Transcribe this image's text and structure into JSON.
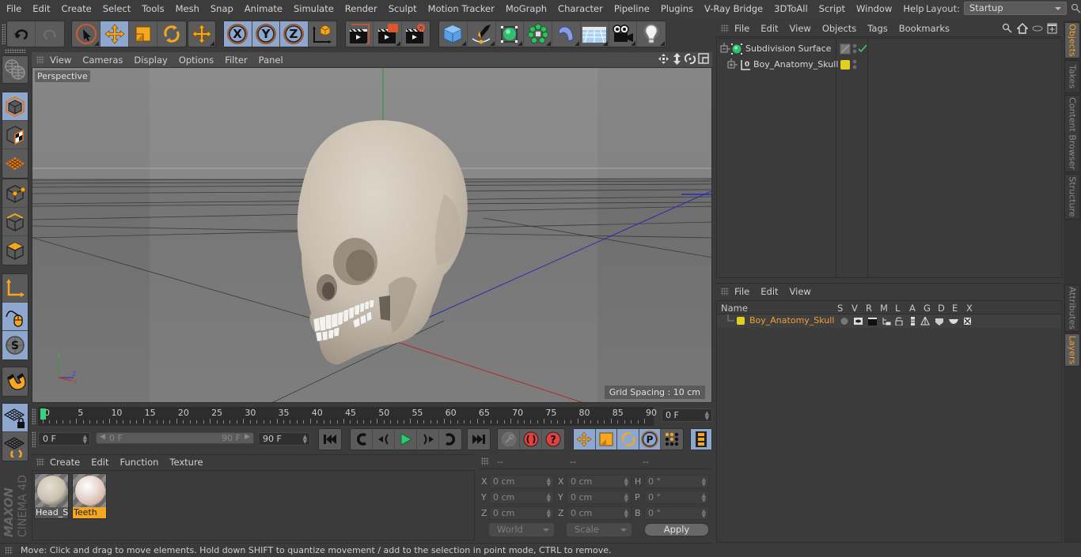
{
  "app": "Cinema 4D",
  "menubar": {
    "items": [
      "File",
      "Edit",
      "Create",
      "Select",
      "Tools",
      "Mesh",
      "Snap",
      "Animate",
      "Simulate",
      "Render",
      "Sculpt",
      "Motion Tracker",
      "MoGraph",
      "Character",
      "Pipeline",
      "Plugins",
      "V-Ray Bridge",
      "3DToAll",
      "Script",
      "Window",
      "Help"
    ],
    "layout_label": "Layout:",
    "layout_value": "Startup"
  },
  "toolbar": {
    "icons": [
      "undo-icon",
      "redo-icon",
      "select-live-icon",
      "move-icon",
      "scale-icon",
      "rotate-icon",
      "move-recent-icon",
      "x-axis-icon",
      "y-axis-icon",
      "z-axis-icon",
      "world-coords-icon",
      "render-view-icon",
      "render-picture-viewer-icon",
      "render-settings-icon",
      "cube-primitive-icon",
      "pen-spline-icon",
      "subdivision-surface-icon",
      "mograph-cloner-icon",
      "deformer-bend-icon",
      "floor-environment-icon",
      "camera-icon",
      "light-icon"
    ]
  },
  "leftbar": {
    "icons": [
      "make-editable-icon",
      "model-mode-icon",
      "texture-mode-icon",
      "workplane-mode-icon",
      "points-mode-icon",
      "edges-mode-icon",
      "polygons-mode-icon",
      "axis-mode-icon",
      "tweak-mode-icon",
      "solo-mode-icon",
      "snapping-icon",
      "locked-workplane-icon",
      "planar-workplane-icon"
    ]
  },
  "viewport": {
    "menu": [
      "View",
      "Cameras",
      "Display",
      "Options",
      "Filter",
      "Panel"
    ],
    "camera_label": "Perspective",
    "grid_spacing": "Grid Spacing : 10 cm",
    "axis_labels": {
      "y": "Y",
      "z": "Z",
      "x": "X"
    },
    "object": "Boy_Anatomy_Skull"
  },
  "timeline": {
    "ticks": [
      "0",
      "5",
      "10",
      "15",
      "20",
      "25",
      "30",
      "35",
      "40",
      "45",
      "50",
      "55",
      "60",
      "65",
      "70",
      "75",
      "80",
      "85",
      "90"
    ],
    "current_frame": "0 F",
    "start_field": "0 F",
    "range_start": "0 F",
    "range_end": "90 F",
    "end_field": "90 F",
    "max_frame": 90,
    "current_value": 0
  },
  "transport": {
    "buttons": [
      "go-to-start",
      "go-to-previous-keyframe",
      "play-backwards",
      "play-forwards",
      "go-to-next-keyframe",
      "go-to-end"
    ],
    "record_buttons": [
      "motion-record",
      "record-active-objects",
      "autokeying"
    ],
    "key_buttons": [
      "key-position",
      "key-scale",
      "key-rotation",
      "key-parameter",
      "key-point-level-animation",
      "timeline-window"
    ]
  },
  "materials": {
    "menu": [
      "Create",
      "Edit",
      "Function",
      "Texture"
    ],
    "items": [
      {
        "name": "Head_Sk",
        "selected": false,
        "color": "#d8d0c0"
      },
      {
        "name": "Teeth",
        "selected": true,
        "color": "#f0e2dc"
      }
    ]
  },
  "coordinates": {
    "header": [
      "--",
      "--",
      "--"
    ],
    "rows": [
      {
        "l1": "X",
        "v1": "0 cm",
        "l2": "X",
        "v2": "0 cm",
        "l3": "H",
        "v3": "0 °"
      },
      {
        "l1": "Y",
        "v1": "0 cm",
        "l2": "Y",
        "v2": "0 cm",
        "l3": "P",
        "v3": "0 °"
      },
      {
        "l1": "Z",
        "v1": "0 cm",
        "l2": "Z",
        "v2": "0 cm",
        "l3": "B",
        "v3": "0 °"
      }
    ],
    "mode_dropdown": "World",
    "size_dropdown": "Scale",
    "apply_label": "Apply"
  },
  "status": {
    "text": "Move: Click and drag to move elements. Hold down SHIFT to quantize movement / add to the selection in point mode, CTRL to remove."
  },
  "brand": {
    "maxon": "MAXON",
    "product": "CINEMA 4D"
  },
  "object_manager": {
    "menu": [
      "File",
      "Edit",
      "View",
      "Objects",
      "Tags",
      "Bookmarks"
    ],
    "objects": [
      {
        "name": "Subdivision Surface",
        "icon": "subdivision-surface-icon",
        "enabled": true
      },
      {
        "name": "Boy_Anatomy_Skull",
        "icon": "null-object-icon",
        "layer_color": "#e0d020"
      }
    ]
  },
  "layer_manager": {
    "menu": [
      "File",
      "Edit",
      "View"
    ],
    "columns": [
      "Name",
      "S",
      "V",
      "R",
      "M",
      "L",
      "A",
      "G",
      "D",
      "E",
      "X"
    ],
    "layers": [
      {
        "name": "Boy_Anatomy_Skull",
        "color": "#e0d020"
      }
    ]
  },
  "right_tabs": {
    "top": [
      {
        "label": "Objects",
        "active": true
      },
      {
        "label": "Takes",
        "active": false
      },
      {
        "label": "Content Browser",
        "active": false
      },
      {
        "label": "Structure",
        "active": false
      }
    ],
    "bottom": [
      {
        "label": "Attributes",
        "active": false
      },
      {
        "label": "Layers",
        "active": true
      }
    ]
  },
  "colors": {
    "accent": "#f5a623",
    "selected_tool": "#8ea7cf",
    "layer_yellow": "#e0d020",
    "active_tab_text": "#f0a030"
  }
}
